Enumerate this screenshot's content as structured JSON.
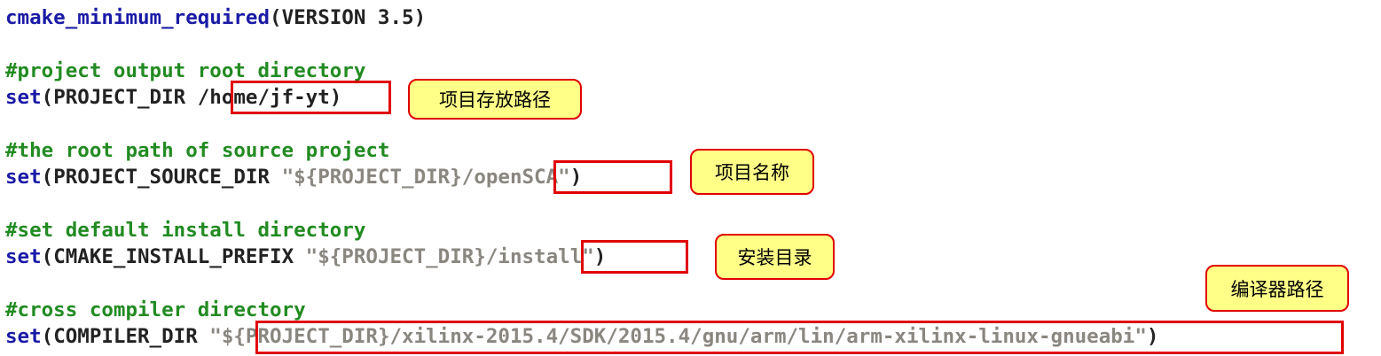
{
  "code": {
    "line1": {
      "fn": "cmake_minimum_required",
      "open": "(",
      "arg": "VERSION",
      "num": " 3.5",
      "close": ")"
    },
    "comment_project_dir": "#project output root directory",
    "set_project_dir": {
      "kw": "set",
      "open": "(",
      "name": "PROJECT_DIR ",
      "value": "/home/jf-yt",
      "close": ")"
    },
    "comment_source": "#the root path of source project",
    "set_source_dir": {
      "kw": "set",
      "open": "(",
      "name": "PROJECT_SOURCE_DIR ",
      "q1": "\"",
      "var": "${PROJECT_DIR}/",
      "value": "openSCA",
      "q2": "\"",
      "close": ")"
    },
    "comment_install": "#set default install directory",
    "set_install": {
      "kw": "set",
      "open": "(",
      "name": "CMAKE_INSTALL_PREFIX ",
      "q1": "\"",
      "var": "${PROJECT_DIR}/",
      "value": "install",
      "q2": "\"",
      "close": ")"
    },
    "comment_compiler": "#cross compiler directory",
    "set_compiler": {
      "kw": "set",
      "open": "(",
      "name": "COMPILER_DIR ",
      "q1": "\"",
      "value": "${PROJECT_DIR}/xilinx-2015.4/SDK/2015.4/gnu/arm/lin/arm-xilinx-linux-gnueabi",
      "q2": "\"",
      "close": ")"
    }
  },
  "callouts": {
    "project_dir": "项目存放路径",
    "project_name": "项目名称",
    "install_dir": "安装目录",
    "compiler_path": "编译器路径"
  },
  "colors": {
    "keyword": "#1a1aa6",
    "comment": "#228b22",
    "string": "#8a8680",
    "highlight": "#e00000",
    "callout_bg": "#ffff88"
  }
}
